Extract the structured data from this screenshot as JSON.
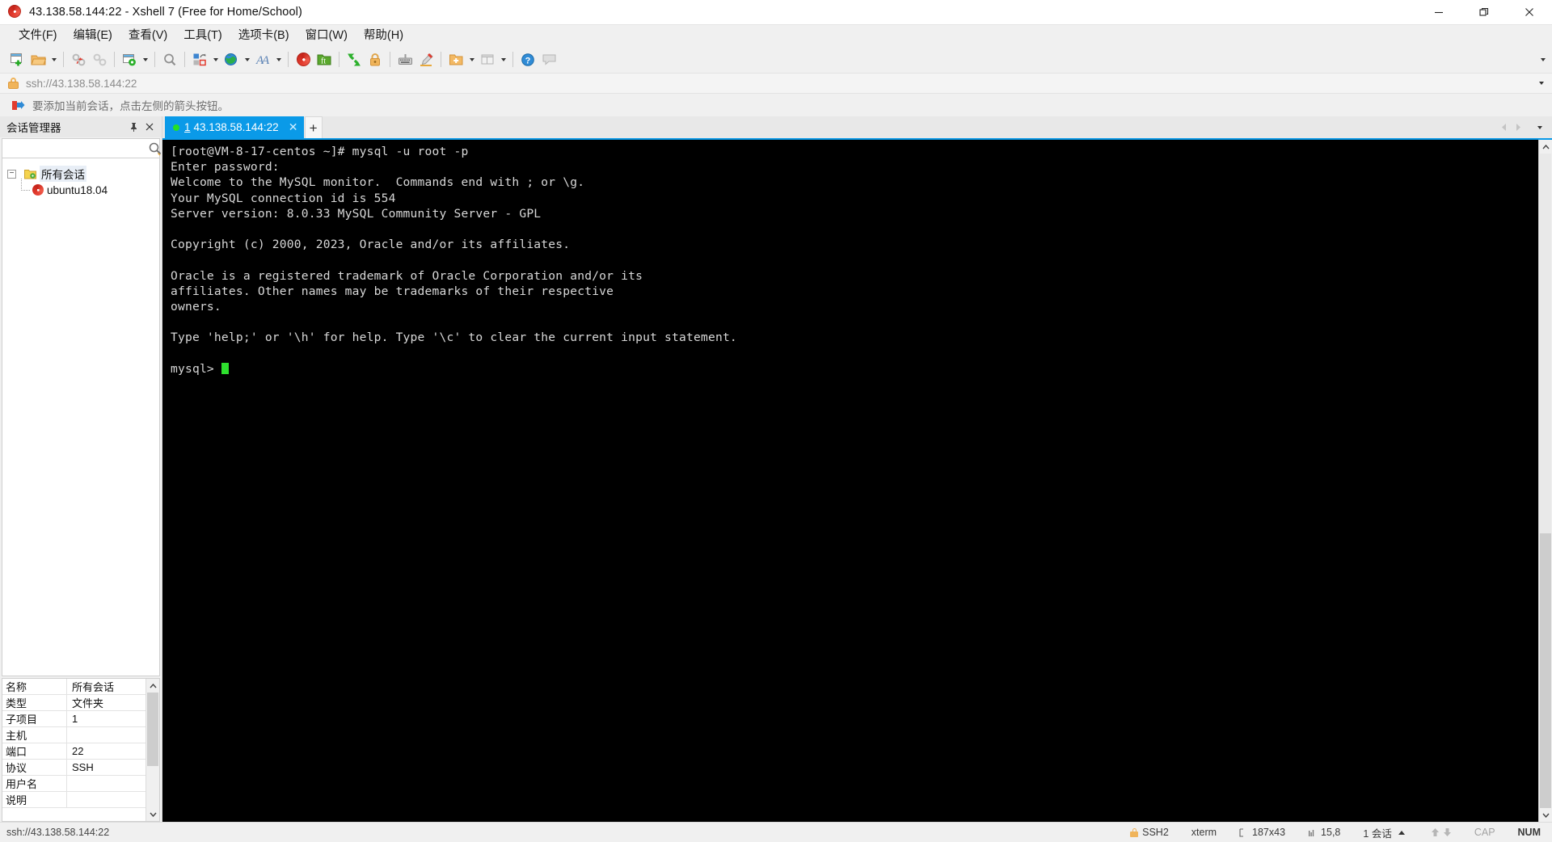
{
  "window": {
    "title": "43.138.58.144:22 - Xshell 7 (Free for Home/School)",
    "icon": "xshell-spiral-icon",
    "controls": {
      "minimize": "minimize-button",
      "restore": "restore-button",
      "close": "close-button"
    }
  },
  "menubar": {
    "items": [
      {
        "label": "文件(F)",
        "name": "menu-file"
      },
      {
        "label": "编辑(E)",
        "name": "menu-edit"
      },
      {
        "label": "查看(V)",
        "name": "menu-view"
      },
      {
        "label": "工具(T)",
        "name": "menu-tools"
      },
      {
        "label": "选项卡(B)",
        "name": "menu-tab"
      },
      {
        "label": "窗口(W)",
        "name": "menu-window"
      },
      {
        "label": "帮助(H)",
        "name": "menu-help"
      }
    ]
  },
  "toolbar": {
    "icons": [
      "new-session-icon",
      "open-folder-icon",
      "disconnect-icon",
      "reconnect-icon",
      "session-properties-icon",
      "find-icon",
      "transfer-file-icon",
      "globe-icon",
      "font-icon",
      "xshell-icon",
      "xftp-icon",
      "fullscreen-icon",
      "lock-icon",
      "keyboard-icon",
      "highlight-icon",
      "add-folder-icon",
      "layout-icon",
      "help-icon",
      "chat-icon"
    ],
    "overflow_label": "toolbar-overflow"
  },
  "address_bar": {
    "value": "ssh://43.138.58.144:22",
    "lock_icon": "lock-icon"
  },
  "hint_bar": {
    "text": "要添加当前会话，点击左侧的箭头按钮。",
    "icon": "red-arrow-icon"
  },
  "session_manager": {
    "title": "会话管理器",
    "pin_label": "📌",
    "close_label": "✕",
    "search": {
      "value": "",
      "placeholder": ""
    },
    "tree": {
      "root": {
        "label": "所有会话",
        "expanded": true,
        "toggle": "−"
      },
      "children": [
        {
          "label": "ubuntu18.04",
          "icon": "xshell-session-icon"
        }
      ]
    },
    "properties": {
      "rows": [
        {
          "key": "名称",
          "value": "所有会话"
        },
        {
          "key": "类型",
          "value": "文件夹"
        },
        {
          "key": "子项目",
          "value": "1"
        },
        {
          "key": "主机",
          "value": ""
        },
        {
          "key": "端口",
          "value": "22"
        },
        {
          "key": "协议",
          "value": "SSH"
        },
        {
          "key": "用户名",
          "value": ""
        },
        {
          "key": "说明",
          "value": ""
        }
      ]
    }
  },
  "tabs": {
    "items": [
      {
        "number": "1",
        "label": "43.138.58.144:22",
        "active": true,
        "status": "connected",
        "close_label": "✕"
      }
    ],
    "add_label": "+"
  },
  "terminal": {
    "lines": [
      "[root@VM-8-17-centos ~]# mysql -u root -p",
      "Enter password:",
      "Welcome to the MySQL monitor.  Commands end with ; or \\g.",
      "Your MySQL connection id is 554",
      "Server version: 8.0.33 MySQL Community Server - GPL",
      "",
      "Copyright (c) 2000, 2023, Oracle and/or its affiliates.",
      "",
      "Oracle is a registered trademark of Oracle Corporation and/or its",
      "affiliates. Other names may be trademarks of their respective",
      "owners.",
      "",
      "Type 'help;' or '\\h' for help. Type '\\c' to clear the current input statement.",
      ""
    ],
    "prompt": "mysql> ",
    "cursor": true,
    "background": "#000000",
    "foreground": "#d8d8d8",
    "cursor_color": "#2ee02e"
  },
  "status_bar": {
    "left": "ssh://43.138.58.144:22",
    "protocol": "SSH2",
    "term_type": "xterm",
    "size": "187x43",
    "cursor_pos": "15,8",
    "sessions": "1 会话",
    "cap": "CAP",
    "num": "NUM"
  }
}
